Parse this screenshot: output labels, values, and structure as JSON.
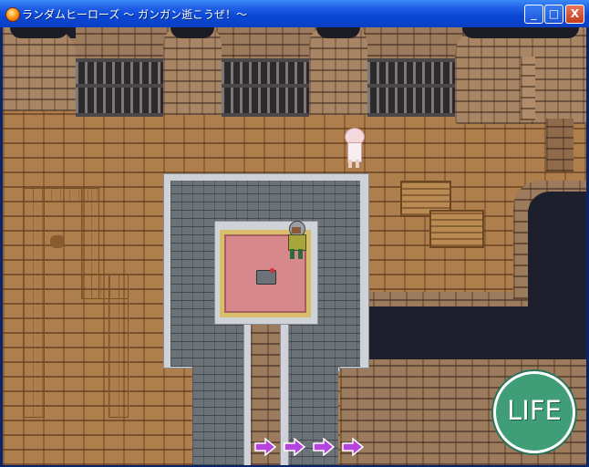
{
  "window": {
    "title": "ランダムヒーローズ 〜 ガンガン逝こうぜ！〜",
    "buttons": {
      "minimize": "_",
      "maximize": "□",
      "close": "X"
    }
  },
  "hud": {
    "life_label": "LIFE",
    "life_color": "#3f9e78",
    "arrow_color": "#b844e0",
    "arrows": [
      "right-arrow",
      "right-arrow",
      "right-arrow",
      "right-arrow"
    ]
  },
  "colors": {
    "floor": "#ae7e4c",
    "wall": "#9c7a5c",
    "stone": "#6c7378",
    "void": "#1d1f2c",
    "carpet": "#d7888c"
  }
}
